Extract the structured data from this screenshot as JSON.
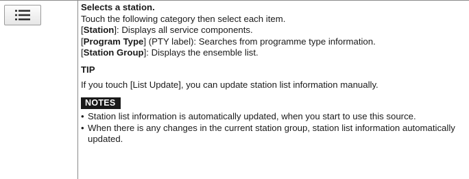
{
  "icon": {
    "name": "list-icon"
  },
  "heading": "Selects a station.",
  "intro": "Touch the following category then select each item.",
  "items": [
    {
      "open": "[",
      "term": "Station",
      "close": "]",
      "desc": ": Displays all service components."
    },
    {
      "open": "[",
      "term": "Program Type",
      "close": "]",
      "desc": " (PTY label): Searches from programme type information."
    },
    {
      "open": "[",
      "term": "Station Group",
      "close": "]",
      "desc": ": Displays the ensemble list."
    }
  ],
  "tip": {
    "heading": "TIP",
    "text": "If you touch [List Update], you can update station list information manually."
  },
  "notes": {
    "label": "NOTES",
    "items": [
      "Station list information is automatically updated, when you start to use this source.",
      "When there is any changes in the current station group, station list information automatically updated."
    ]
  }
}
